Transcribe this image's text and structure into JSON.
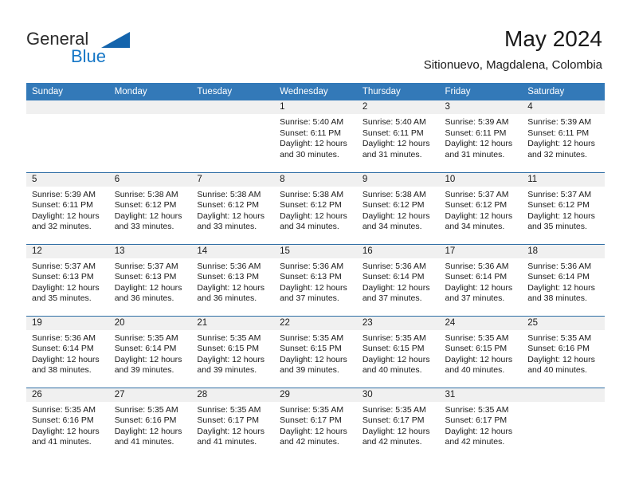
{
  "brand": {
    "name_part1": "General",
    "name_part2": "Blue",
    "accent_color": "#1476c6",
    "triangle_color": "#1464ac"
  },
  "header": {
    "title": "May 2024",
    "location": "Sitionuevo, Magdalena, Colombia"
  },
  "calendar": {
    "header_bg": "#3379b8",
    "daynum_bg": "#f0f0f0",
    "row_divider_color": "#2e6da4",
    "weekday_headers": [
      "Sunday",
      "Monday",
      "Tuesday",
      "Wednesday",
      "Thursday",
      "Friday",
      "Saturday"
    ],
    "weeks": [
      [
        {
          "day": ""
        },
        {
          "day": ""
        },
        {
          "day": ""
        },
        {
          "day": "1",
          "sunrise": "Sunrise: 5:40 AM",
          "sunset": "Sunset: 6:11 PM",
          "daylight_line1": "Daylight: 12 hours",
          "daylight_line2": "and 30 minutes."
        },
        {
          "day": "2",
          "sunrise": "Sunrise: 5:40 AM",
          "sunset": "Sunset: 6:11 PM",
          "daylight_line1": "Daylight: 12 hours",
          "daylight_line2": "and 31 minutes."
        },
        {
          "day": "3",
          "sunrise": "Sunrise: 5:39 AM",
          "sunset": "Sunset: 6:11 PM",
          "daylight_line1": "Daylight: 12 hours",
          "daylight_line2": "and 31 minutes."
        },
        {
          "day": "4",
          "sunrise": "Sunrise: 5:39 AM",
          "sunset": "Sunset: 6:11 PM",
          "daylight_line1": "Daylight: 12 hours",
          "daylight_line2": "and 32 minutes."
        }
      ],
      [
        {
          "day": "5",
          "sunrise": "Sunrise: 5:39 AM",
          "sunset": "Sunset: 6:11 PM",
          "daylight_line1": "Daylight: 12 hours",
          "daylight_line2": "and 32 minutes."
        },
        {
          "day": "6",
          "sunrise": "Sunrise: 5:38 AM",
          "sunset": "Sunset: 6:12 PM",
          "daylight_line1": "Daylight: 12 hours",
          "daylight_line2": "and 33 minutes."
        },
        {
          "day": "7",
          "sunrise": "Sunrise: 5:38 AM",
          "sunset": "Sunset: 6:12 PM",
          "daylight_line1": "Daylight: 12 hours",
          "daylight_line2": "and 33 minutes."
        },
        {
          "day": "8",
          "sunrise": "Sunrise: 5:38 AM",
          "sunset": "Sunset: 6:12 PM",
          "daylight_line1": "Daylight: 12 hours",
          "daylight_line2": "and 34 minutes."
        },
        {
          "day": "9",
          "sunrise": "Sunrise: 5:38 AM",
          "sunset": "Sunset: 6:12 PM",
          "daylight_line1": "Daylight: 12 hours",
          "daylight_line2": "and 34 minutes."
        },
        {
          "day": "10",
          "sunrise": "Sunrise: 5:37 AM",
          "sunset": "Sunset: 6:12 PM",
          "daylight_line1": "Daylight: 12 hours",
          "daylight_line2": "and 34 minutes."
        },
        {
          "day": "11",
          "sunrise": "Sunrise: 5:37 AM",
          "sunset": "Sunset: 6:12 PM",
          "daylight_line1": "Daylight: 12 hours",
          "daylight_line2": "and 35 minutes."
        }
      ],
      [
        {
          "day": "12",
          "sunrise": "Sunrise: 5:37 AM",
          "sunset": "Sunset: 6:13 PM",
          "daylight_line1": "Daylight: 12 hours",
          "daylight_line2": "and 35 minutes."
        },
        {
          "day": "13",
          "sunrise": "Sunrise: 5:37 AM",
          "sunset": "Sunset: 6:13 PM",
          "daylight_line1": "Daylight: 12 hours",
          "daylight_line2": "and 36 minutes."
        },
        {
          "day": "14",
          "sunrise": "Sunrise: 5:36 AM",
          "sunset": "Sunset: 6:13 PM",
          "daylight_line1": "Daylight: 12 hours",
          "daylight_line2": "and 36 minutes."
        },
        {
          "day": "15",
          "sunrise": "Sunrise: 5:36 AM",
          "sunset": "Sunset: 6:13 PM",
          "daylight_line1": "Daylight: 12 hours",
          "daylight_line2": "and 37 minutes."
        },
        {
          "day": "16",
          "sunrise": "Sunrise: 5:36 AM",
          "sunset": "Sunset: 6:14 PM",
          "daylight_line1": "Daylight: 12 hours",
          "daylight_line2": "and 37 minutes."
        },
        {
          "day": "17",
          "sunrise": "Sunrise: 5:36 AM",
          "sunset": "Sunset: 6:14 PM",
          "daylight_line1": "Daylight: 12 hours",
          "daylight_line2": "and 37 minutes."
        },
        {
          "day": "18",
          "sunrise": "Sunrise: 5:36 AM",
          "sunset": "Sunset: 6:14 PM",
          "daylight_line1": "Daylight: 12 hours",
          "daylight_line2": "and 38 minutes."
        }
      ],
      [
        {
          "day": "19",
          "sunrise": "Sunrise: 5:36 AM",
          "sunset": "Sunset: 6:14 PM",
          "daylight_line1": "Daylight: 12 hours",
          "daylight_line2": "and 38 minutes."
        },
        {
          "day": "20",
          "sunrise": "Sunrise: 5:35 AM",
          "sunset": "Sunset: 6:14 PM",
          "daylight_line1": "Daylight: 12 hours",
          "daylight_line2": "and 39 minutes."
        },
        {
          "day": "21",
          "sunrise": "Sunrise: 5:35 AM",
          "sunset": "Sunset: 6:15 PM",
          "daylight_line1": "Daylight: 12 hours",
          "daylight_line2": "and 39 minutes."
        },
        {
          "day": "22",
          "sunrise": "Sunrise: 5:35 AM",
          "sunset": "Sunset: 6:15 PM",
          "daylight_line1": "Daylight: 12 hours",
          "daylight_line2": "and 39 minutes."
        },
        {
          "day": "23",
          "sunrise": "Sunrise: 5:35 AM",
          "sunset": "Sunset: 6:15 PM",
          "daylight_line1": "Daylight: 12 hours",
          "daylight_line2": "and 40 minutes."
        },
        {
          "day": "24",
          "sunrise": "Sunrise: 5:35 AM",
          "sunset": "Sunset: 6:15 PM",
          "daylight_line1": "Daylight: 12 hours",
          "daylight_line2": "and 40 minutes."
        },
        {
          "day": "25",
          "sunrise": "Sunrise: 5:35 AM",
          "sunset": "Sunset: 6:16 PM",
          "daylight_line1": "Daylight: 12 hours",
          "daylight_line2": "and 40 minutes."
        }
      ],
      [
        {
          "day": "26",
          "sunrise": "Sunrise: 5:35 AM",
          "sunset": "Sunset: 6:16 PM",
          "daylight_line1": "Daylight: 12 hours",
          "daylight_line2": "and 41 minutes."
        },
        {
          "day": "27",
          "sunrise": "Sunrise: 5:35 AM",
          "sunset": "Sunset: 6:16 PM",
          "daylight_line1": "Daylight: 12 hours",
          "daylight_line2": "and 41 minutes."
        },
        {
          "day": "28",
          "sunrise": "Sunrise: 5:35 AM",
          "sunset": "Sunset: 6:17 PM",
          "daylight_line1": "Daylight: 12 hours",
          "daylight_line2": "and 41 minutes."
        },
        {
          "day": "29",
          "sunrise": "Sunrise: 5:35 AM",
          "sunset": "Sunset: 6:17 PM",
          "daylight_line1": "Daylight: 12 hours",
          "daylight_line2": "and 42 minutes."
        },
        {
          "day": "30",
          "sunrise": "Sunrise: 5:35 AM",
          "sunset": "Sunset: 6:17 PM",
          "daylight_line1": "Daylight: 12 hours",
          "daylight_line2": "and 42 minutes."
        },
        {
          "day": "31",
          "sunrise": "Sunrise: 5:35 AM",
          "sunset": "Sunset: 6:17 PM",
          "daylight_line1": "Daylight: 12 hours",
          "daylight_line2": "and 42 minutes."
        },
        {
          "day": ""
        }
      ]
    ]
  }
}
